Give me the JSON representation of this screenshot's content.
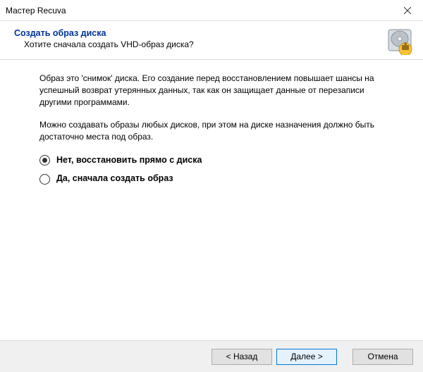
{
  "window": {
    "title": "Мастер Recuva"
  },
  "header": {
    "title": "Создать образ диска",
    "subtitle": "Хотите сначала создать VHD-образ диска?"
  },
  "content": {
    "para1": "Образ это 'снимок' диска. Его создание перед восстановлением повышает шансы на успешный возврат утерянных данных, так как он защищает данные от перезаписи другими программами.",
    "para2": "Можно создавать образы любых дисков, при этом на диске назначения должно быть достаточно места под образ."
  },
  "radios": {
    "option1": "Нет, восстановить прямо с диска",
    "option2": "Да, сначала создать образ",
    "selected": 0
  },
  "footer": {
    "back": "< Назад",
    "next": "Далее >",
    "cancel": "Отмена"
  }
}
